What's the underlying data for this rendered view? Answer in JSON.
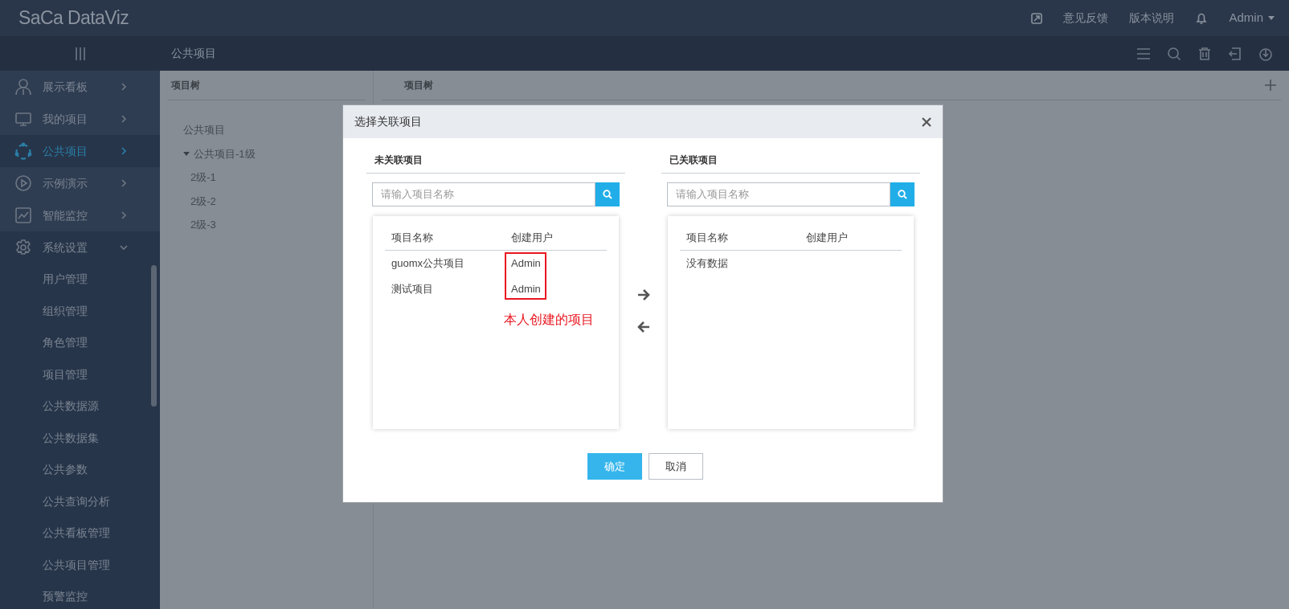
{
  "header": {
    "logo": "SaCa DataViz",
    "links": [
      "意见反馈",
      "版本说明"
    ],
    "user": "Admin"
  },
  "breadcrumb": "公共项目",
  "sidebar": {
    "items": [
      {
        "label": "展示看板",
        "selected": false,
        "expanded": false
      },
      {
        "label": "我的项目",
        "selected": false,
        "expanded": false
      },
      {
        "label": "公共项目",
        "selected": true,
        "expanded": false
      },
      {
        "label": "示例演示",
        "selected": false,
        "expanded": false
      },
      {
        "label": "智能监控",
        "selected": false,
        "expanded": false
      },
      {
        "label": "系统设置",
        "selected": false,
        "expanded": true,
        "children": [
          {
            "label": "用户管理"
          },
          {
            "label": "组织管理"
          },
          {
            "label": "角色管理"
          },
          {
            "label": "项目管理"
          },
          {
            "label": "公共数据源"
          },
          {
            "label": "公共数据集"
          },
          {
            "label": "公共参数"
          },
          {
            "label": "公共查询分析"
          },
          {
            "label": "公共看板管理"
          },
          {
            "label": "公共项目管理"
          },
          {
            "label": "预警监控"
          }
        ]
      }
    ]
  },
  "tree_panel": {
    "title": "项目树",
    "tree": [
      {
        "label": "公共项目"
      },
      {
        "label": "公共项目-1级",
        "expanded": true,
        "children": [
          {
            "label": "2级-1"
          },
          {
            "label": "2级-2"
          },
          {
            "label": "2级-3"
          }
        ]
      }
    ]
  },
  "main_panel": {
    "title": "项目树"
  },
  "dialog": {
    "title": "选择关联项目",
    "lists": [
      {
        "title": "未关联项目",
        "placeholder": "请输入项目名称",
        "columns": [
          "项目名称",
          "创建用户"
        ],
        "rows": [
          [
            "guomx公共项目",
            "Admin"
          ],
          [
            "测试项目",
            "Admin"
          ]
        ],
        "creator_highlighted": true,
        "annotation": "本人创建的项目"
      },
      {
        "title": "已关联项目",
        "placeholder": "请输入项目名称",
        "columns": [
          "项目名称",
          "创建用户"
        ],
        "empty_text": "没有数据"
      }
    ],
    "buttons": [
      {
        "label": "确定",
        "kind": "primary"
      },
      {
        "label": "取消",
        "kind": "default"
      }
    ]
  }
}
